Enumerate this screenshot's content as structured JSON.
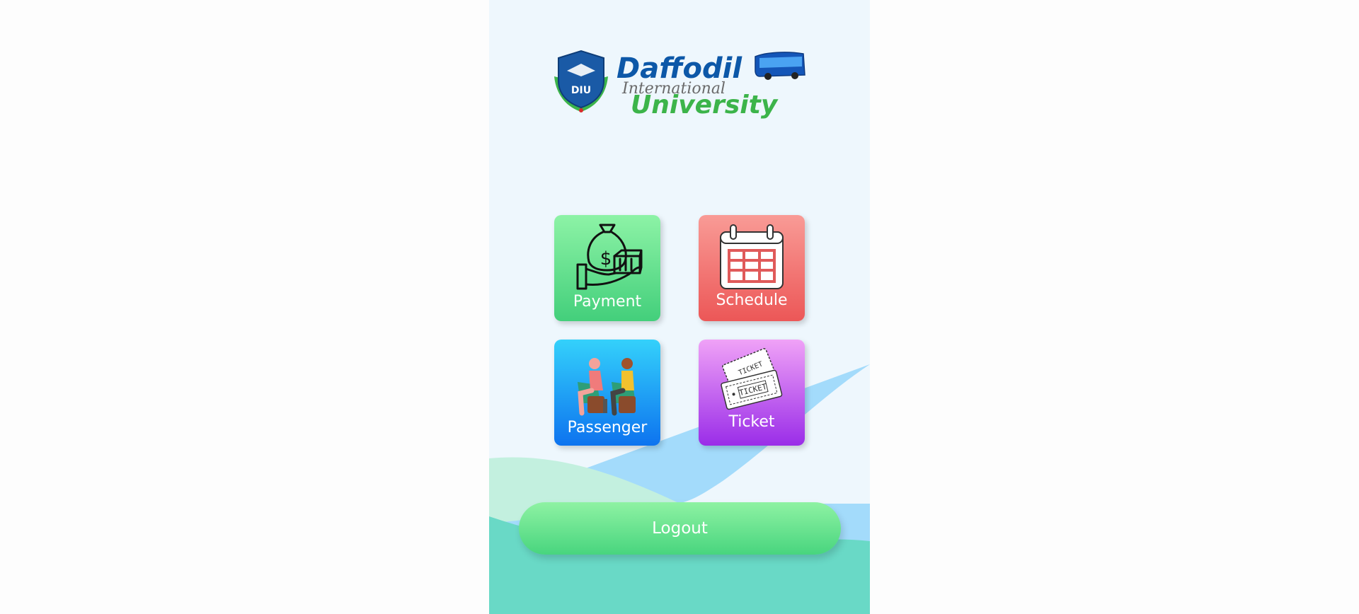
{
  "logo": {
    "line1": "Daffodil",
    "line2": "International",
    "line3": "University",
    "emblem_text": "DIU"
  },
  "tiles": [
    {
      "label": "Payment",
      "icon": "money-bag-hand-icon"
    },
    {
      "label": "Schedule",
      "icon": "calendar-icon"
    },
    {
      "label": "Passenger",
      "icon": "passengers-icon"
    },
    {
      "label": "Ticket",
      "icon": "ticket-icon"
    }
  ],
  "logout": {
    "label": "Logout"
  },
  "colors": {
    "background": "#eef7fd",
    "wave_blue": "#a3dbfb",
    "wave_mint": "#c3f0df",
    "wave_teal": "#69d9c6",
    "payment": "#4fd682",
    "schedule": "#ef6060",
    "passenger": "#1596f5",
    "ticket": "#b24dee",
    "logo_blue": "#0d58a8",
    "logo_green": "#3cb44a"
  }
}
